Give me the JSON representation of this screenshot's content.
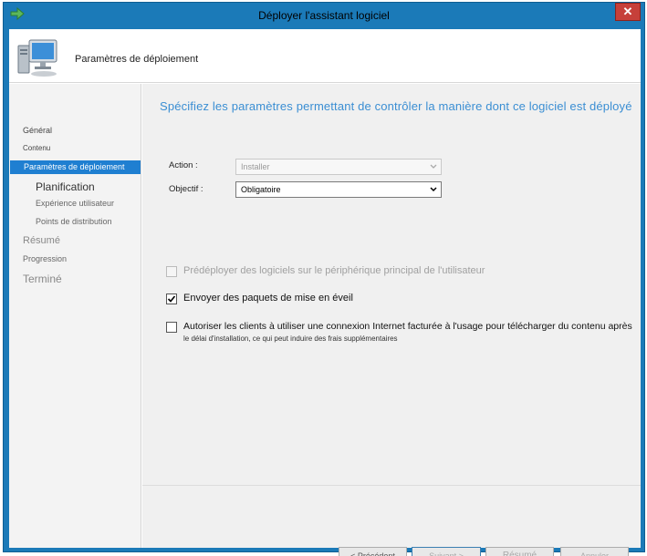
{
  "window": {
    "title": "Déployer l'assistant logiciel",
    "close_label": "✕"
  },
  "header": {
    "title": "Paramètres de déploiement",
    "icon": "computer-icon"
  },
  "nav": {
    "items": [
      {
        "label": "Général"
      },
      {
        "label": "Contenu"
      },
      {
        "label": "Paramètres de déploiement"
      },
      {
        "label": "Planification"
      },
      {
        "label": "Expérience utilisateur"
      },
      {
        "label": "Points de distribution"
      },
      {
        "label": "Résumé"
      },
      {
        "label": "Progression"
      },
      {
        "label": "Terminé"
      }
    ],
    "selected_index": 2
  },
  "main": {
    "heading": "Spécifiez les paramètres permettant de contrôler la manière dont ce logiciel est déployé",
    "action_label": "Action :",
    "action_value": "Installer",
    "objectif_label": "Objectif :",
    "objectif_value": "Obligatoire",
    "options": [
      {
        "label": "Prédéployer des logiciels sur le périphérique principal de l'utilisateur",
        "checked": false,
        "enabled": false
      },
      {
        "label": "Envoyer des paquets de mise en éveil",
        "checked": true,
        "enabled": true
      },
      {
        "label": "Autoriser les clients à utiliser une connexion Internet facturée à l'usage pour télécharger du contenu après",
        "sub": "le délai d'installation, ce qui peut induire des frais supplémentaires",
        "checked": false,
        "enabled": true
      }
    ]
  },
  "footer": {
    "previous_label": "< Précédent",
    "next_label": "Suivant >",
    "summary_label": "Résumé",
    "cancel_label": "Annuler"
  },
  "colors": {
    "frame": "#1b7ab8",
    "accent": "#1f7fd1",
    "heading": "#3a8ed3",
    "close": "#c6403a"
  }
}
